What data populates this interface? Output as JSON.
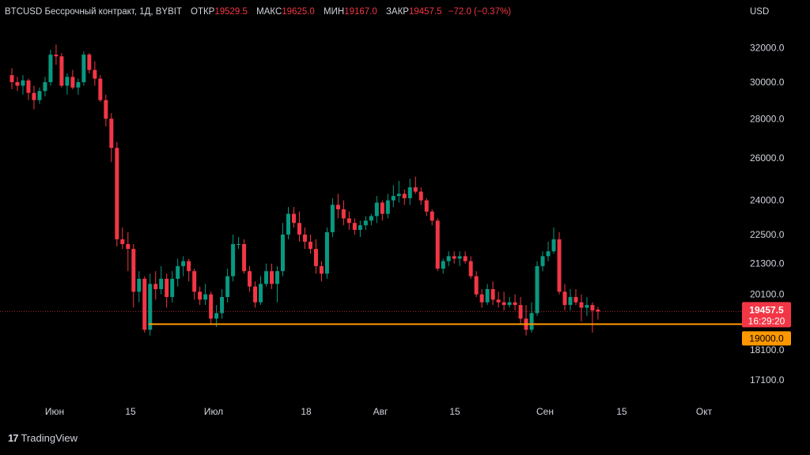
{
  "header": {
    "symbol": "BTCUSD Бессрочный контракт, 1Д, BYBIT",
    "open_label": "ОТКР",
    "open_value": "19529.5",
    "high_label": "МАКС",
    "high_value": "19625.0",
    "low_label": "МИН",
    "low_value": "19167.0",
    "close_label": "ЗАКР",
    "close_value": "19457.5",
    "change": "−72.0 (−0.37%)"
  },
  "currency": "USD",
  "brand": {
    "logo": "17",
    "name": "TradingView"
  },
  "chart_data": {
    "type": "candlestick",
    "y_scale": "log",
    "ylim": [
      16500,
      33500
    ],
    "y_ticks": [
      {
        "value": 32000,
        "label": "32000.0"
      },
      {
        "value": 30000,
        "label": "30000.0"
      },
      {
        "value": 28000,
        "label": "28000.0"
      },
      {
        "value": 26000,
        "label": "26000.0"
      },
      {
        "value": 24000,
        "label": "24000.0"
      },
      {
        "value": 22500,
        "label": "22500.0"
      },
      {
        "value": 21300,
        "label": "21300.0"
      },
      {
        "value": 20100,
        "label": "20100.0"
      },
      {
        "value": 18100,
        "label": "18100.0"
      },
      {
        "value": 17100,
        "label": "17100.0"
      }
    ],
    "x_ticks": [
      "Июн",
      "15",
      "Июл",
      "18",
      "Авг",
      "15",
      "Сен",
      "15",
      "Окт"
    ],
    "last_price": {
      "value": 19457.5,
      "label": "19457.5",
      "countdown": "16:29:20",
      "color": "#f23645"
    },
    "horizontal_line": {
      "value": 19000,
      "label": "19000.0",
      "color": "#ff9800"
    },
    "up_color": "#089981",
    "down_color": "#f23645",
    "candles": [
      [
        30400,
        30800,
        29600,
        30000
      ],
      [
        30000,
        30300,
        29500,
        29800
      ],
      [
        29800,
        30400,
        29300,
        30100
      ],
      [
        30100,
        30200,
        29000,
        29400
      ],
      [
        29400,
        29800,
        28500,
        29000
      ],
      [
        29000,
        29700,
        28800,
        29500
      ],
      [
        29500,
        30300,
        29200,
        30000
      ],
      [
        30000,
        31900,
        29800,
        31600
      ],
      [
        31600,
        32200,
        31000,
        31500
      ],
      [
        31500,
        31700,
        29700,
        29800
      ],
      [
        29800,
        30500,
        29300,
        30300
      ],
      [
        30300,
        30700,
        29600,
        29700
      ],
      [
        29700,
        30200,
        29300,
        30000
      ],
      [
        30000,
        31800,
        29800,
        31600
      ],
      [
        31600,
        31700,
        30500,
        30700
      ],
      [
        30700,
        31200,
        29800,
        30200
      ],
      [
        30200,
        30400,
        28900,
        29000
      ],
      [
        29000,
        29300,
        27600,
        28000
      ],
      [
        28000,
        28300,
        25800,
        26500
      ],
      [
        26500,
        26800,
        22000,
        22300
      ],
      [
        22300,
        22800,
        21900,
        22100
      ],
      [
        22100,
        22600,
        21000,
        21900
      ],
      [
        21900,
        22100,
        19600,
        20200
      ],
      [
        20200,
        21000,
        19800,
        20700
      ],
      [
        20700,
        20800,
        18700,
        18800
      ],
      [
        18800,
        20900,
        18600,
        20500
      ],
      [
        20500,
        21000,
        19900,
        20300
      ],
      [
        20300,
        21200,
        20100,
        20700
      ],
      [
        20700,
        20900,
        19600,
        20000
      ],
      [
        20000,
        21000,
        19800,
        20700
      ],
      [
        20700,
        21500,
        20400,
        21200
      ],
      [
        21200,
        21600,
        20800,
        21400
      ],
      [
        21400,
        21500,
        20600,
        21000
      ],
      [
        21000,
        21100,
        19900,
        20200
      ],
      [
        20200,
        20400,
        19700,
        19900
      ],
      [
        19900,
        20500,
        19700,
        20100
      ],
      [
        20100,
        20200,
        19000,
        19200
      ],
      [
        19200,
        19700,
        18900,
        19400
      ],
      [
        19400,
        20300,
        19200,
        20000
      ],
      [
        20000,
        21100,
        19800,
        20800
      ],
      [
        20800,
        22500,
        20600,
        22100
      ],
      [
        22100,
        22400,
        21900,
        22100
      ],
      [
        22100,
        22300,
        20900,
        21000
      ],
      [
        21000,
        21200,
        20200,
        20400
      ],
      [
        20400,
        20600,
        19600,
        19800
      ],
      [
        19800,
        20800,
        19700,
        20500
      ],
      [
        20500,
        21300,
        20400,
        21000
      ],
      [
        21000,
        21300,
        20300,
        20500
      ],
      [
        20500,
        21200,
        19800,
        21000
      ],
      [
        21000,
        23000,
        20800,
        22500
      ],
      [
        22500,
        23700,
        22300,
        23400
      ],
      [
        23400,
        23700,
        22800,
        23000
      ],
      [
        23000,
        23500,
        22200,
        22500
      ],
      [
        22500,
        22800,
        21900,
        22200
      ],
      [
        22200,
        22500,
        21700,
        21900
      ],
      [
        21900,
        22300,
        20900,
        21200
      ],
      [
        21200,
        21400,
        20600,
        20900
      ],
      [
        20900,
        22800,
        20700,
        22600
      ],
      [
        22600,
        24100,
        22400,
        23800
      ],
      [
        23800,
        24300,
        23200,
        23600
      ],
      [
        23600,
        24000,
        22900,
        23200
      ],
      [
        23200,
        23500,
        22700,
        23000
      ],
      [
        23000,
        23200,
        22500,
        22700
      ],
      [
        22700,
        23100,
        22400,
        22900
      ],
      [
        22900,
        23300,
        22700,
        23100
      ],
      [
        23100,
        23400,
        22900,
        23300
      ],
      [
        23300,
        24200,
        23000,
        23900
      ],
      [
        23900,
        24000,
        23100,
        23400
      ],
      [
        23400,
        24300,
        23200,
        24000
      ],
      [
        24000,
        24700,
        23700,
        24200
      ],
      [
        24200,
        24900,
        23900,
        24300
      ],
      [
        24300,
        24500,
        23800,
        24100
      ],
      [
        24100,
        25000,
        23800,
        24600
      ],
      [
        24600,
        25100,
        24300,
        24400
      ],
      [
        24400,
        24600,
        23800,
        24000
      ],
      [
        24000,
        24100,
        23300,
        23500
      ],
      [
        23500,
        23600,
        22900,
        23100
      ],
      [
        23100,
        23200,
        21000,
        21100
      ],
      [
        21100,
        21500,
        20900,
        21400
      ],
      [
        21400,
        21800,
        21200,
        21600
      ],
      [
        21600,
        21800,
        21300,
        21500
      ],
      [
        21500,
        21800,
        21200,
        21600
      ],
      [
        21600,
        21800,
        21300,
        21400
      ],
      [
        21400,
        21600,
        20700,
        20800
      ],
      [
        20800,
        21000,
        20000,
        20100
      ],
      [
        20100,
        20300,
        19600,
        19800
      ],
      [
        19800,
        20500,
        19700,
        20300
      ],
      [
        20300,
        20600,
        19700,
        19900
      ],
      [
        19900,
        20200,
        19600,
        19800
      ],
      [
        19800,
        20200,
        19500,
        19700
      ],
      [
        19700,
        20000,
        19600,
        19800
      ],
      [
        19800,
        20100,
        19500,
        19700
      ],
      [
        19700,
        20000,
        19000,
        19200
      ],
      [
        19200,
        19700,
        18600,
        18800
      ],
      [
        18800,
        19800,
        18700,
        19400
      ],
      [
        19400,
        21400,
        19300,
        21200
      ],
      [
        21200,
        21800,
        21000,
        21600
      ],
      [
        21600,
        22200,
        21400,
        21800
      ],
      [
        21800,
        22800,
        21700,
        22300
      ],
      [
        22300,
        22600,
        20100,
        20200
      ],
      [
        20200,
        20500,
        19500,
        19700
      ],
      [
        19700,
        20300,
        19500,
        20000
      ],
      [
        20000,
        20300,
        19700,
        19800
      ],
      [
        19800,
        20100,
        19100,
        19600
      ],
      [
        19600,
        20000,
        19300,
        19700
      ],
      [
        19700,
        19800,
        18700,
        19500
      ],
      [
        19529.5,
        19625,
        19167,
        19457.5
      ]
    ]
  }
}
